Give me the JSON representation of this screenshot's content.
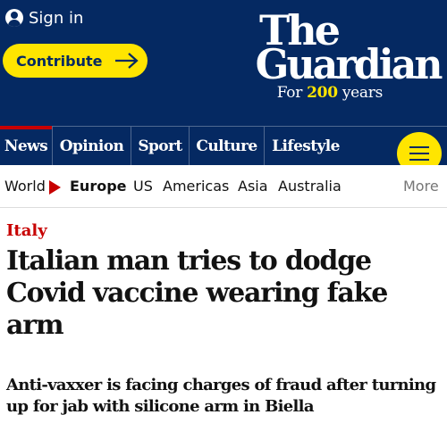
{
  "header": {
    "signin_label": "Sign in",
    "contribute_label": "Contribute",
    "logo": {
      "the": "The",
      "guardian": "Guardian",
      "for_prefix": "For ",
      "years_number": "200",
      "years_suffix": " years"
    },
    "menu_icon": "hamburger-menu-icon"
  },
  "pillars": [
    {
      "label": "News",
      "active": true
    },
    {
      "label": "Opinion",
      "active": false
    },
    {
      "label": "Sport",
      "active": false
    },
    {
      "label": "Culture",
      "active": false
    },
    {
      "label": "Lifestyle",
      "active": false
    }
  ],
  "subnav": {
    "items": [
      {
        "label": "World"
      },
      {
        "label": "Europe",
        "current": true
      },
      {
        "label": "US"
      },
      {
        "label": "Americas"
      },
      {
        "label": "Asia"
      },
      {
        "label": "Australia"
      }
    ],
    "more_label": "More"
  },
  "article": {
    "kicker": "Italy",
    "headline": "Italian man tries to dodge Covid vaccine wearing fake arm",
    "standfirst": "Anti-vaxxer is facing charges of fraud after turning up for jab with silicone arm in Biella"
  },
  "colors": {
    "brand_blue": "#052962",
    "accent_yellow": "#ffe500",
    "news_red": "#c70000"
  }
}
